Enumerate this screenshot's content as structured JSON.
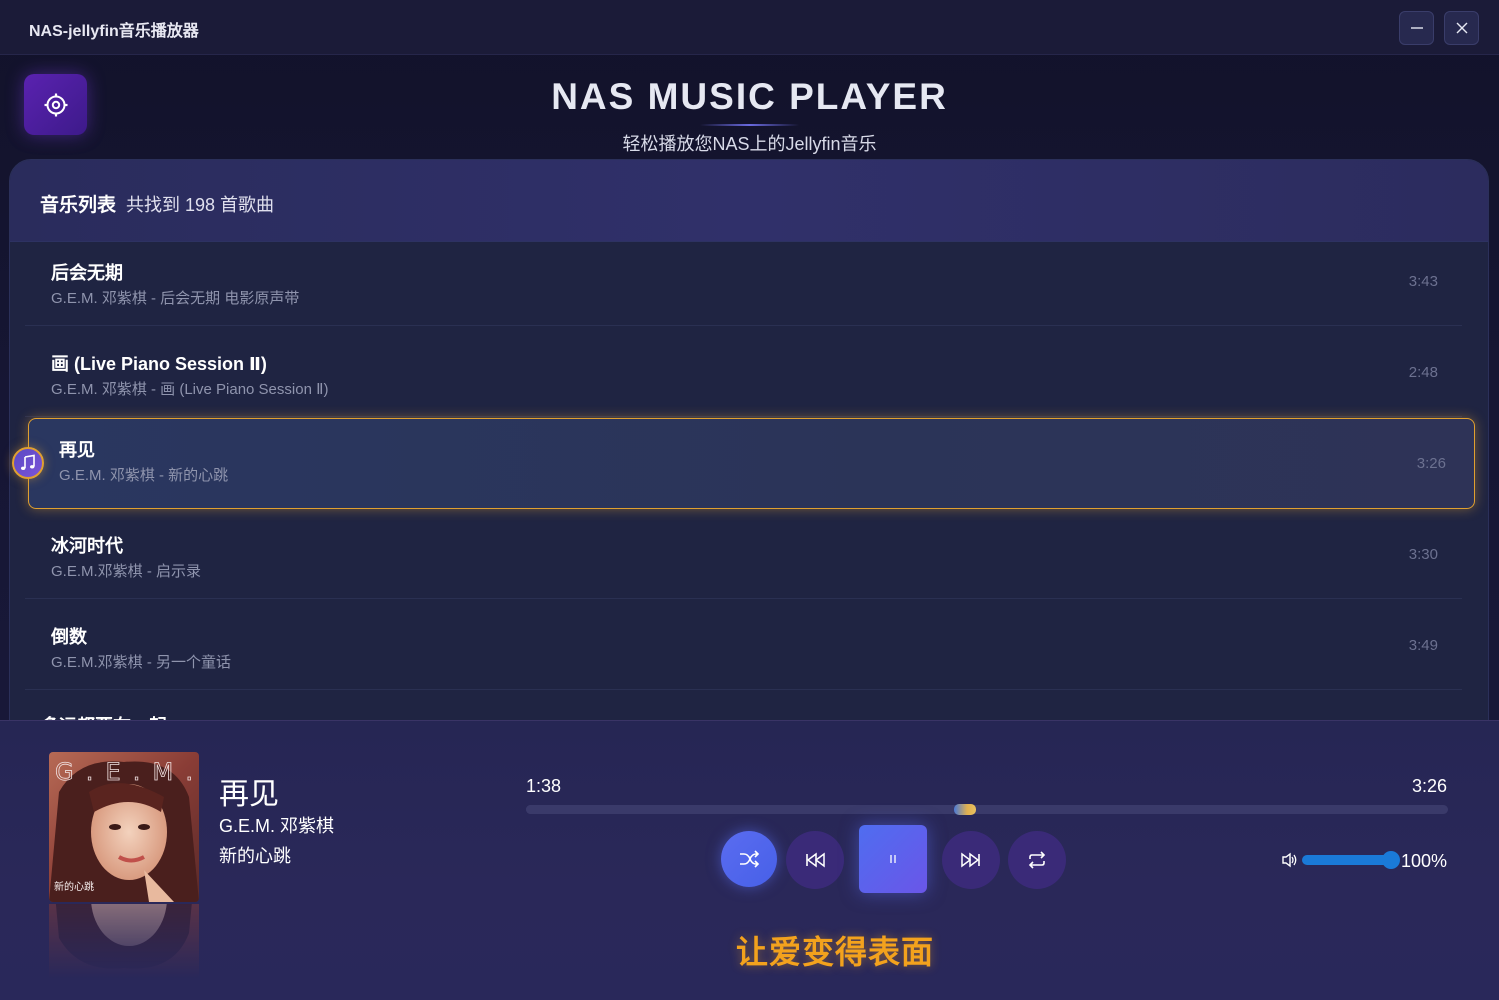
{
  "window": {
    "title": "NAS-jellyfin音乐播放器",
    "minimize_label": "—",
    "close_label": "✕"
  },
  "header": {
    "title": "NAS MUSIC PLAYER",
    "subtitle": "轻松播放您NAS上的Jellyfin音乐"
  },
  "settings": {
    "icon": "gear-icon"
  },
  "song_list": {
    "title": "音乐列表",
    "count_text": "共找到 198 首歌曲",
    "songs": [
      {
        "title": "后会无期",
        "meta": "G.E.M. 邓紫棋 - 后会无期 电影原声带",
        "duration": "3:43",
        "active": false
      },
      {
        "title": "画 (Live Piano Session Ⅱ)",
        "meta": "G.E.M. 邓紫棋 - 画 (Live Piano Session Ⅱ)",
        "duration": "2:48",
        "active": false
      },
      {
        "title": "再见",
        "meta": "G.E.M. 邓紫棋 - 新的心跳",
        "duration": "3:26",
        "active": true
      },
      {
        "title": "冰河时代",
        "meta": "G.E.M.邓紫棋 - 启示录",
        "duration": "3:30",
        "active": false
      },
      {
        "title": "倒数",
        "meta": "G.E.M.邓紫棋 - 另一个童话",
        "duration": "3:49",
        "active": false
      }
    ],
    "partial_next_title": "多远都要在一起"
  },
  "player": {
    "cover_text": "G.E.M.",
    "cover_caption": "新的心跳",
    "title": "再见",
    "artist": "G.E.M. 邓紫棋",
    "album": "新的心跳",
    "current_time": "1:38",
    "total_time": "3:26",
    "progress_fraction": 0.476,
    "volume_percent": 100,
    "volume_text": "100%",
    "lyric": "让爱变得表面",
    "accent_color": "#f3a21d",
    "controls": [
      "shuffle-icon",
      "previous-icon",
      "pause-icon",
      "next-icon",
      "repeat-icon"
    ]
  }
}
